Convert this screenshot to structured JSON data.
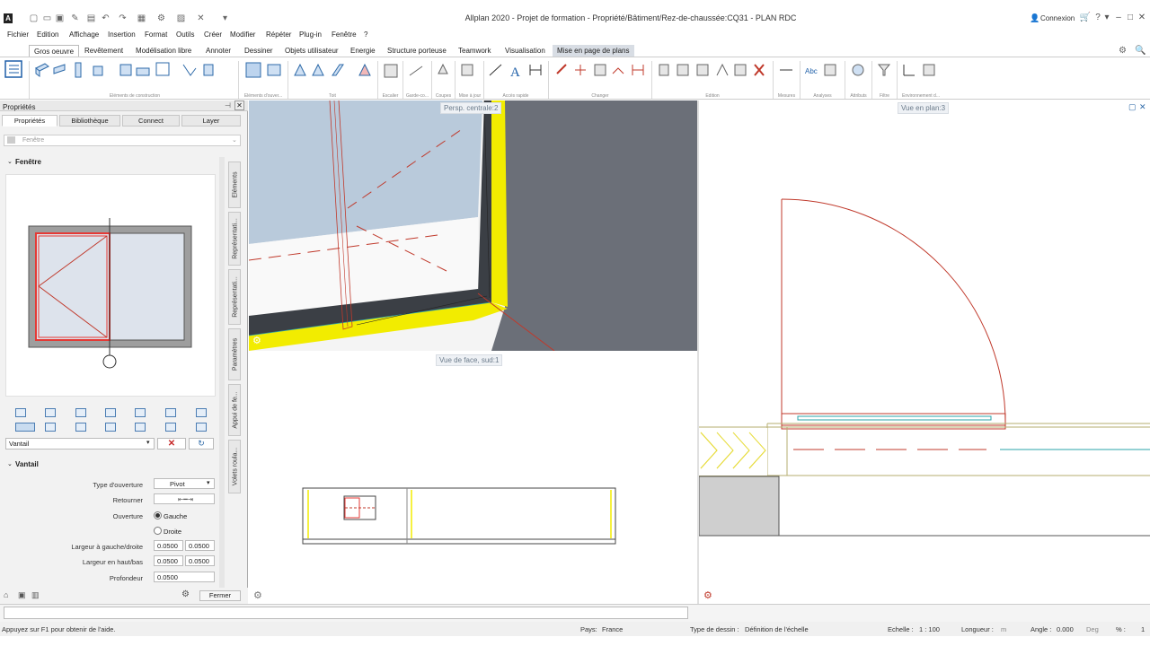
{
  "app": {
    "title": "Allplan 2020 - Projet de formation - Propriété/Bâtiment/Rez-de-chaussée:CQ31 - PLAN RDC",
    "icon_letter": "A",
    "connexion": "Connexion"
  },
  "menu": [
    "Fichier",
    "Edition",
    "Affichage",
    "Insertion",
    "Format",
    "Outils",
    "Créer",
    "Modifier",
    "Répéter",
    "Plug-in",
    "Fenêtre",
    "?"
  ],
  "ribbon_tabs": [
    "Gros oeuvre",
    "Revêtement",
    "Modélisation libre",
    "Annoter",
    "Dessiner",
    "Objets utilisateur",
    "Energie",
    "Structure porteuse",
    "Teamwork",
    "Visualisation",
    "Mise en page de plans"
  ],
  "ribbon_groups": [
    "Eléments de construction",
    "Eléments d'ouver...",
    "Toit",
    "Escalier",
    "Garde-co...",
    "Coupes",
    "Mise à jour",
    "Accès rapide",
    "Changer",
    "Edition",
    "Mesures",
    "Analyses",
    "Attributs",
    "Filtre",
    "Environnement d..."
  ],
  "panel": {
    "title": "Propriétés",
    "tabs": [
      "Propriétés",
      "Bibliothèque",
      "Connect",
      "Layer"
    ],
    "combo_value": "Fenêtre",
    "section_window": "Fenêtre",
    "side_tabs": [
      "Eléments",
      "Représentati...",
      "Représentati...",
      "Paramètres",
      "Appui de fe...",
      "Volets roula..."
    ],
    "component_select": "Vantail",
    "section_vantail": "Vantail",
    "fields": {
      "type_ouverture_label": "Type d'ouverture",
      "type_ouverture_value": "Pivot",
      "retourner_label": "Retourner",
      "ouverture_label": "Ouverture",
      "opt_gauche": "Gauche",
      "opt_droite": "Droite",
      "largeur_gd_label": "Largeur à gauche/droite",
      "largeur_gd_1": "0.0500",
      "largeur_gd_2": "0.0500",
      "largeur_hb_label": "Largeur en haut/bas",
      "largeur_hb_1": "0.0500",
      "largeur_hb_2": "0.0500",
      "profondeur_label": "Profondeur",
      "profondeur_value": "0.0500"
    },
    "close_button": "Fermer"
  },
  "viewports": {
    "persp_label": "Persp. centrale:2",
    "face_label": "Vue de face, sud:1",
    "plan_label": "Vue en plan:3"
  },
  "status": {
    "help": "Appuyez sur F1 pour obtenir de l'aide.",
    "pays_label": "Pays:",
    "pays_value": "France",
    "type_label": "Type de dessin :",
    "type_value": "Définition de l'échelle",
    "echelle_label": "Echelle :",
    "echelle_value": "1 : 100",
    "longueur_label": "Longueur :",
    "longueur_unit": "m",
    "angle_label": "Angle :",
    "angle_value": "0.000",
    "angle_unit": "Deg",
    "pct_label": "% :",
    "pct_value": "1"
  },
  "colors": {
    "accent": "#4b7db3",
    "red_line": "#c0392b",
    "yellow": "#f2ec00",
    "wall_dark": "#3b3f45",
    "view_grey": "#6b6f78"
  }
}
